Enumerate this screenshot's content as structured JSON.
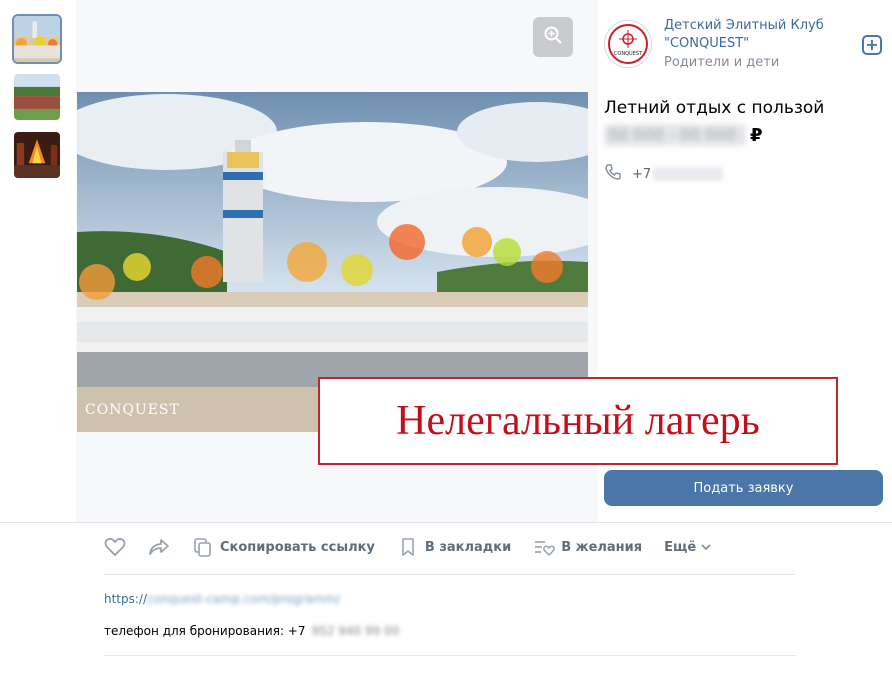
{
  "thumbnails": [
    {
      "name": "thumb-camp-colors",
      "active": true
    },
    {
      "name": "thumb-camp-group",
      "active": false
    },
    {
      "name": "thumb-campfire",
      "active": false
    }
  ],
  "photo": {
    "watermark": "CONQUEST"
  },
  "stamp": {
    "text": "Нелегальный лагерь"
  },
  "seller": {
    "name": "Детский Элитный Клуб \"CONQUEST\"",
    "category": "Родители и дети",
    "logo_text": "CONQUEST",
    "add_label": "+"
  },
  "item": {
    "title": "Летний отдых с пользой",
    "price_blurred": "00 000 - 00 000",
    "currency": "₽",
    "phone_prefix": "+7",
    "apply_label": "Подать заявку"
  },
  "actions": {
    "like_icon": "heart-icon",
    "share_icon": "share-icon",
    "copy_label": "Скопировать ссылку",
    "bookmark_label": "В закладки",
    "wishlist_label": "В желания",
    "more_label": "Ещё"
  },
  "description": {
    "link_prefix": "https://",
    "link_blurred": "conquest-camp.com/programm/",
    "phone_label": "телефон для бронирования: +7",
    "phone_blurred": "952 940 99 00"
  },
  "colors": {
    "accent": "#4a76a8",
    "stamp": "#c0101e",
    "link": "#3a6aa0"
  }
}
